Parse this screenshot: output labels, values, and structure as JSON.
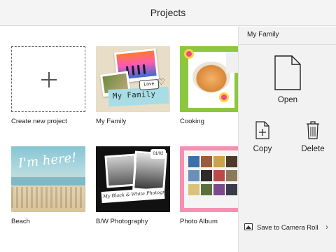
{
  "header": {
    "title": "Projects"
  },
  "tiles": [
    {
      "label": "Create new project"
    },
    {
      "label": "My Family",
      "banner": "My Family",
      "sticker": "Love"
    },
    {
      "label": "Cooking"
    },
    {
      "label": "Beach",
      "overlay": "I'm here!"
    },
    {
      "label": "B/W Photography",
      "banner": "My Black & White Photography",
      "badge": "01/02"
    },
    {
      "label": "Photo Album"
    }
  ],
  "panel": {
    "title": "My Family",
    "open_label": "Open",
    "copy_label": "Copy",
    "delete_label": "Delete",
    "save_label": "Save to Camera Roll"
  },
  "colors": {
    "header_bg": "#f4f4f4",
    "panel_bg": "#f2f2f2",
    "cooking_bg": "#8dc63f",
    "album_bg": "#f78fb3"
  }
}
